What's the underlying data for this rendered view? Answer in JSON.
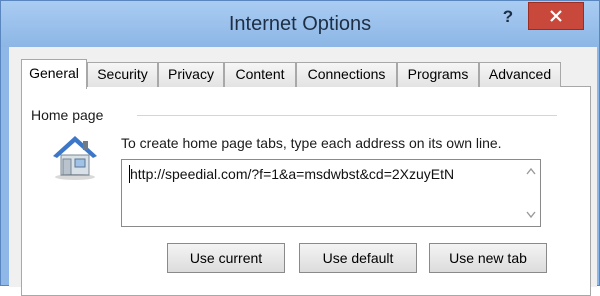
{
  "window": {
    "title": "Internet Options",
    "help_label": "?",
    "close_icon": "close-icon"
  },
  "tabs": [
    {
      "label": "General",
      "active": true
    },
    {
      "label": "Security"
    },
    {
      "label": "Privacy"
    },
    {
      "label": "Content"
    },
    {
      "label": "Connections"
    },
    {
      "label": "Programs"
    },
    {
      "label": "Advanced"
    }
  ],
  "home_page": {
    "group_label": "Home page",
    "description": "To create home page tabs, type each address on its own line.",
    "url_value": "http://speedial.com/?f=1&a=msdwbst&cd=2XzuyEtN",
    "icon": "house-icon"
  },
  "buttons": {
    "use_current": "Use current",
    "use_default": "Use default",
    "use_new_tab": "Use new tab"
  },
  "colors": {
    "titlebar": "#8db6e6",
    "close": "#c9483c",
    "panel": "#ffffff"
  }
}
